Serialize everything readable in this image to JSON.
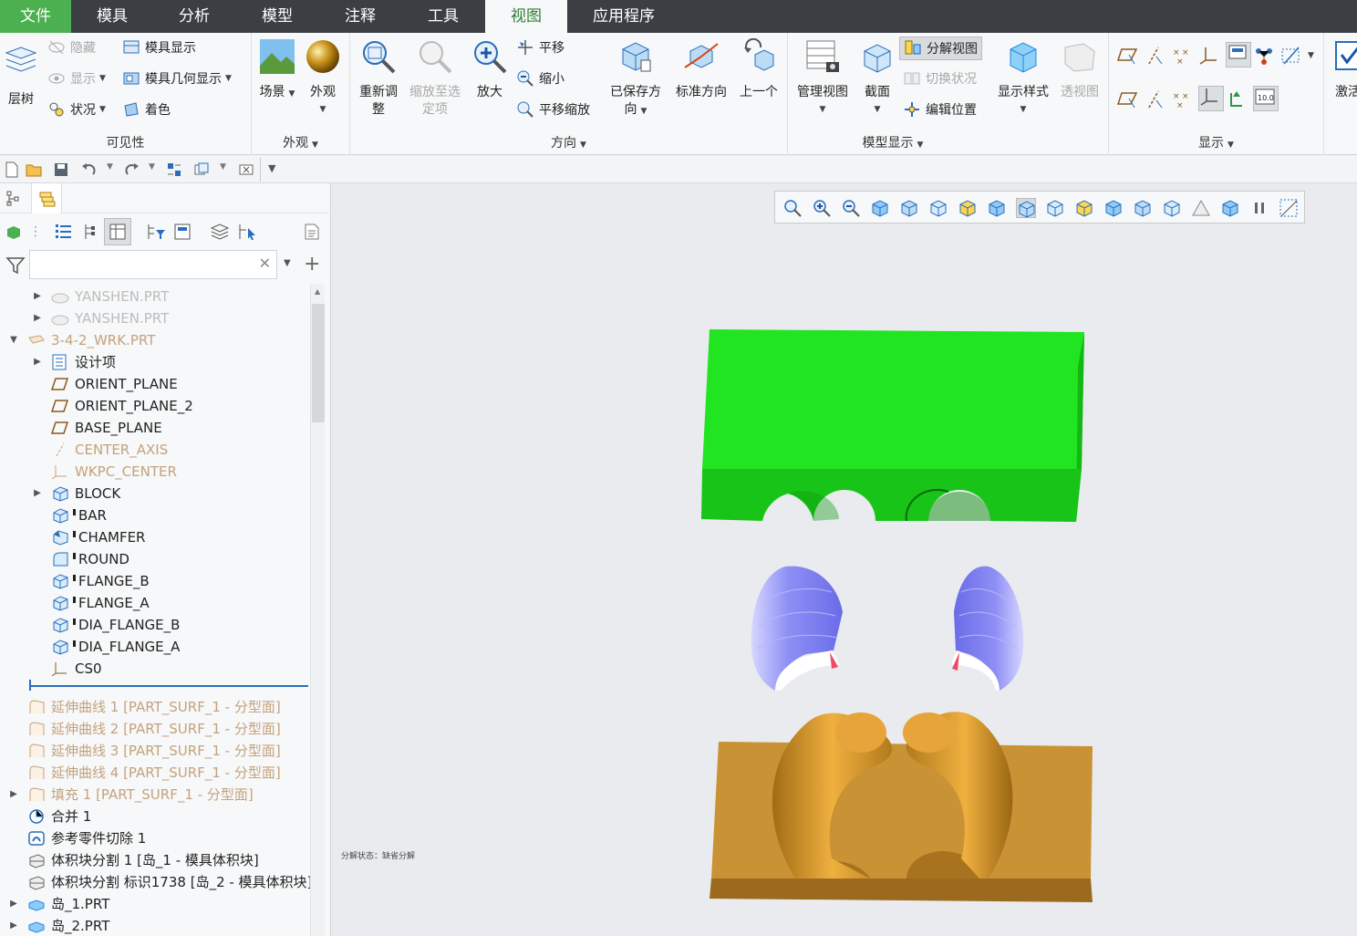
{
  "menubar": {
    "tabs": [
      {
        "label": "文件"
      },
      {
        "label": "模具"
      },
      {
        "label": "分析"
      },
      {
        "label": "模型"
      },
      {
        "label": "注释"
      },
      {
        "label": "工具"
      },
      {
        "label": "视图"
      },
      {
        "label": "应用程序"
      }
    ],
    "active_index": 6
  },
  "ribbon": {
    "visibility": {
      "label": "可见性",
      "layer_tree": "层树",
      "hide": "隐藏",
      "show": "显示",
      "status": "状况",
      "mold_display": "模具显示",
      "mold_geom_display": "模具几何显示",
      "shade": "着色"
    },
    "appearance": {
      "label": "外观",
      "scene": "场景",
      "appearance": "外观"
    },
    "orientation": {
      "label": "方向",
      "refit_1": "重新调",
      "refit_2": "整",
      "zoom_sel_1": "缩放至选",
      "zoom_sel_2": "定项",
      "zoom_in": "放大",
      "pan": "平移",
      "zoom_out": "缩小",
      "pan_zoom": "平移缩放",
      "saved_1": "已保存方",
      "saved_2": "向",
      "standard": "标准方向",
      "previous": "上一个"
    },
    "model_display": {
      "label": "模型显示",
      "manage_views": "管理视图",
      "section": "截面",
      "explode_view": "分解视图",
      "toggle_status": "切换状况",
      "edit_position": "编辑位置"
    },
    "display_style": {
      "display_style": "显示样式",
      "perspective": "透视图"
    },
    "show": {
      "label": "显示",
      "tag_value": "10.0"
    },
    "activate": "激活"
  },
  "left_panel": {
    "search_placeholder": "",
    "tree": [
      {
        "label": "YANSHEN.PRT",
        "state": "dim2"
      },
      {
        "label": "YANSHEN.PRT",
        "state": "dim2"
      },
      {
        "label": "3-4-2_WRK.PRT",
        "state": "dim"
      },
      {
        "label": "设计项",
        "state": "normal"
      },
      {
        "label": "ORIENT_PLANE",
        "state": "normal"
      },
      {
        "label": "ORIENT_PLANE_2",
        "state": "normal"
      },
      {
        "label": "BASE_PLANE",
        "state": "normal"
      },
      {
        "label": "CENTER_AXIS",
        "state": "dim"
      },
      {
        "label": "WKPC_CENTER",
        "state": "dim"
      },
      {
        "label": "BLOCK",
        "state": "normal"
      },
      {
        "label": "BAR",
        "state": "normal"
      },
      {
        "label": "CHAMFER",
        "state": "normal"
      },
      {
        "label": "ROUND",
        "state": "normal"
      },
      {
        "label": "FLANGE_B",
        "state": "normal"
      },
      {
        "label": "FLANGE_A",
        "state": "normal"
      },
      {
        "label": "DIA_FLANGE_B",
        "state": "normal"
      },
      {
        "label": "DIA_FLANGE_A",
        "state": "normal"
      },
      {
        "label": "CS0",
        "state": "normal"
      },
      {
        "label": "延伸曲线 1 [PART_SURF_1 - 分型面]",
        "state": "dim"
      },
      {
        "label": "延伸曲线 2 [PART_SURF_1 - 分型面]",
        "state": "dim"
      },
      {
        "label": "延伸曲线 3 [PART_SURF_1 - 分型面]",
        "state": "dim"
      },
      {
        "label": "延伸曲线 4 [PART_SURF_1 - 分型面]",
        "state": "dim"
      },
      {
        "label": "填充 1 [PART_SURF_1 - 分型面]",
        "state": "dim"
      },
      {
        "label": "合并 1",
        "state": "normal"
      },
      {
        "label": "参考零件切除 1",
        "state": "normal"
      },
      {
        "label": "体积块分割 1 [岛_1 - 模具体积块]",
        "state": "normal"
      },
      {
        "label": "体积块分割 标识1738 [岛_2 - 模具体积块]",
        "state": "normal"
      },
      {
        "label": "岛_1.PRT",
        "state": "normal"
      },
      {
        "label": "岛_2.PRT",
        "state": "normal"
      }
    ]
  },
  "viewport": {
    "status_text": "分解状态：缺省分解",
    "colors": {
      "top_block": "#1ee31e",
      "cores": "#8a8cf0",
      "base_plate": "#c79031"
    }
  }
}
